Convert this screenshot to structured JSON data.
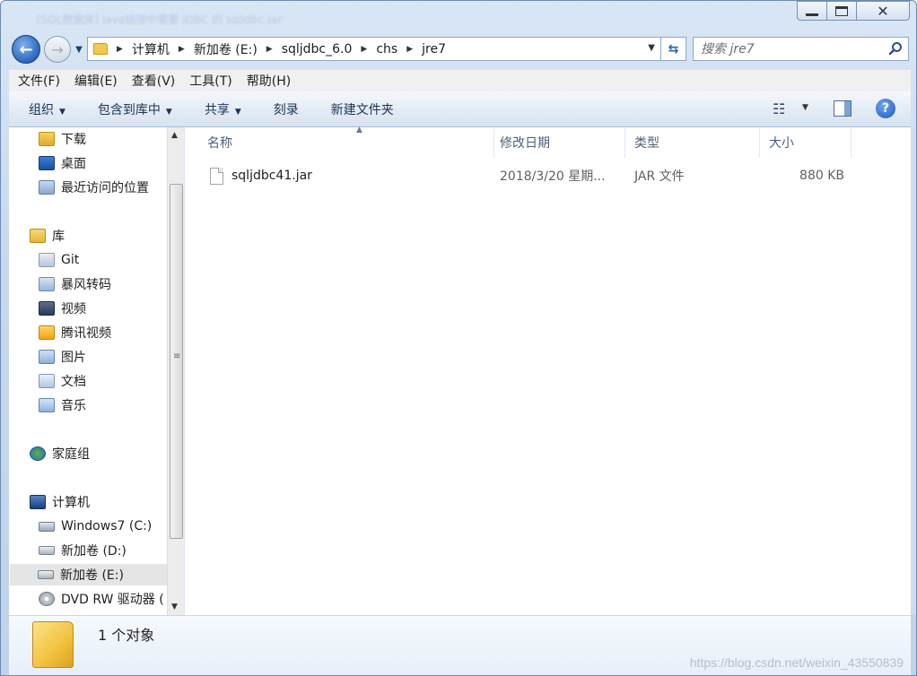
{
  "window": {
    "blurred_title": "[SQL数据库] Java链接中需要 JDBC 的 sqljdbc.jar"
  },
  "nav": {
    "back_label": "←",
    "forward_label": "→"
  },
  "address": {
    "breadcrumbs": [
      "计算机",
      "新加卷 (E:)",
      "sqljdbc_6.0",
      "chs",
      "jre7"
    ]
  },
  "search": {
    "placeholder": "搜索 jre7"
  },
  "menu": {
    "items": [
      "文件(F)",
      "编辑(E)",
      "查看(V)",
      "工具(T)",
      "帮助(H)"
    ]
  },
  "toolbar": {
    "organize": "组织",
    "include_in_library": "包含到库中",
    "share": "共享",
    "burn": "刻录",
    "new_folder": "新建文件夹"
  },
  "sidebar": {
    "items": [
      {
        "label": "下载",
        "icon": "download-folder-icon"
      },
      {
        "label": "桌面",
        "icon": "desktop-icon"
      },
      {
        "label": "最近访问的位置",
        "icon": "recent-places-icon"
      },
      {
        "label": "库",
        "icon": "library-icon"
      },
      {
        "label": "Git",
        "icon": "git-library-icon"
      },
      {
        "label": "暴风转码",
        "icon": "storm-library-icon"
      },
      {
        "label": "视频",
        "icon": "video-library-icon"
      },
      {
        "label": "腾讯视频",
        "icon": "tencent-library-icon"
      },
      {
        "label": "图片",
        "icon": "pictures-library-icon"
      },
      {
        "label": "文档",
        "icon": "documents-library-icon"
      },
      {
        "label": "音乐",
        "icon": "music-library-icon"
      },
      {
        "label": "家庭组",
        "icon": "homegroup-icon"
      },
      {
        "label": "计算机",
        "icon": "computer-icon"
      },
      {
        "label": "Windows7 (C:)",
        "icon": "system-drive-icon"
      },
      {
        "label": "新加卷 (D:)",
        "icon": "drive-icon"
      },
      {
        "label": "新加卷 (E:)",
        "icon": "drive-icon"
      },
      {
        "label": "DVD RW 驱动器 (",
        "icon": "dvd-drive-icon"
      }
    ],
    "selected": "新加卷 (E:)"
  },
  "filelist": {
    "columns": [
      "名称",
      "修改日期",
      "类型",
      "大小"
    ],
    "rows": [
      {
        "name": "sqljdbc41.jar",
        "modified": "2018/3/20 星期...",
        "type": "JAR 文件",
        "size": "880 KB"
      }
    ]
  },
  "details": {
    "count_text": "1 个对象"
  },
  "watermark": "https://blog.csdn.net/weixin_43550839",
  "colors": {
    "chrome": "#c6d8ee",
    "accent": "#2b67bd",
    "folder": "#f1c23e"
  }
}
